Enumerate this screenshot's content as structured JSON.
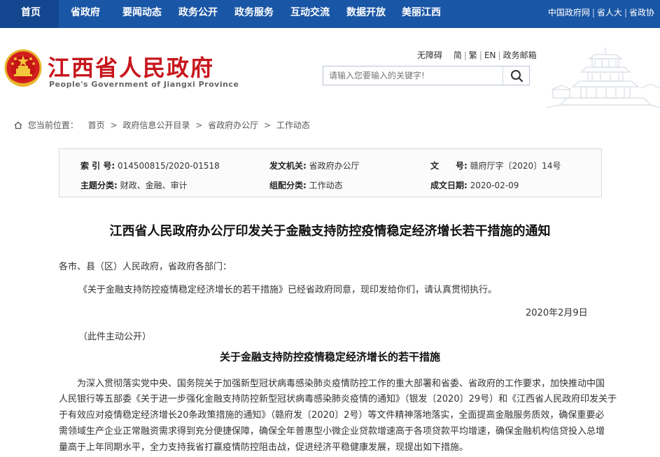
{
  "topnav": {
    "items": [
      "首页",
      "省政府",
      "要闻动态",
      "政务公开",
      "政务服务",
      "互动交流",
      "数据开放",
      "美丽江西"
    ],
    "right_links": [
      "中国政府网",
      "省人大",
      "省政协"
    ]
  },
  "header": {
    "title": "江西省人民政府",
    "subtitle": "People's Government of Jiangxi Province",
    "tools": [
      "无障碍",
      "简",
      "繁",
      "EN",
      "政务邮箱"
    ],
    "search_placeholder": "请输入您要输入的关键字!"
  },
  "breadcrumb": {
    "prefix": "您当前位置：",
    "items": [
      "首页",
      "政府信息公开目录",
      "省政府办公厅",
      "工作动态"
    ]
  },
  "meta": {
    "index_label": "索 引 号:",
    "index_value": "014500815/2020-01518",
    "issuer_label": "发文机关:",
    "issuer_value": "省政府办公厅",
    "docno_label": "文　　号:",
    "docno_value": "赣府厅字〔2020〕14号",
    "topic_label": "主题分类:",
    "topic_value": "财政、金融、审计",
    "category_label": "组配分类:",
    "category_value": "工作动态",
    "date_label": "成文日期:",
    "date_value": "2020-02-09"
  },
  "document": {
    "title": "江西省人民政府办公厅印发关于金融支持防控疫情稳定经济增长若干措施的通知",
    "salutation": "各市、县（区）人民政府，省政府各部门：",
    "para1": "《关于金融支持防控疫情稳定经济增长的若干措施》已经省政府同意，现印发给你们，请认真贯彻执行。",
    "date": "2020年2月9日",
    "note": "（此件主动公开）",
    "subtitle": "关于金融支持防控疫情稳定经济增长的若干措施",
    "body_lines": [
      "为深入贯彻落实党中央、国务院关于加强新型冠状病毒感染肺炎疫情防控工作的重大部署和省委、省政府的工作要求，加快推动中国",
      "人民银行等五部委《关于进一步强化金融支持防控新型冠状病毒感染肺炎疫情的通知》（银发〔2020〕29号）和《江西省人民政府印发关于",
      "于有效应对疫情稳定经济增长20条政策措施的通知》（赣府发〔2020〕2号）等文件精神落地落实，全面提高金融服务质效，确保重要必",
      "需领域生产企业正常融资需求得到充分便捷保障，确保全年普惠型小微企业贷款增速高于各项贷款平均增速，确保金融机构信贷投入总增",
      "量高于上年同期水平，全力支持我省打赢疫情防控阻击战，促进经济平稳健康发展，现提出如下措施。"
    ]
  }
}
